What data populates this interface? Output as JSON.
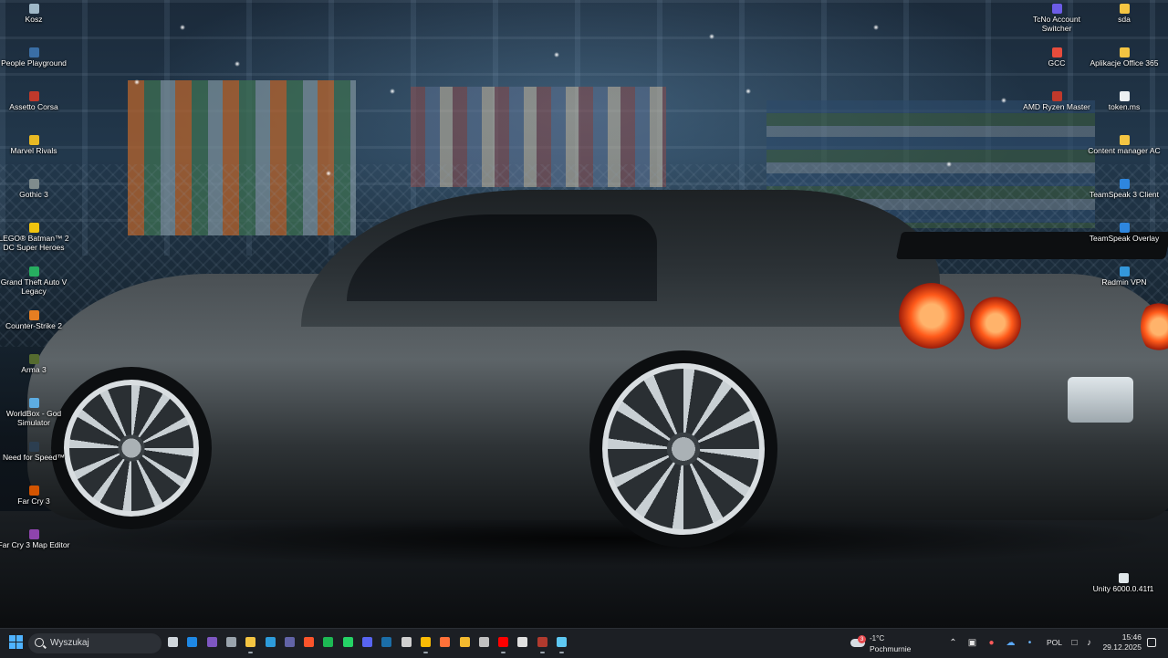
{
  "desktop": {
    "icons_left": [
      {
        "label": "Kosz",
        "icon": "recycle-bin-icon",
        "color": "#9fb8c8"
      },
      {
        "label": "People Playground",
        "icon": "people-playground-icon",
        "color": "#3a6ea5"
      },
      {
        "label": "Assetto Corsa",
        "icon": "assetto-corsa-icon",
        "color": "#c0392b"
      },
      {
        "label": "Marvel Rivals",
        "icon": "marvel-rivals-icon",
        "color": "#e8b923"
      },
      {
        "label": "Gothic 3",
        "icon": "gothic-3-icon",
        "color": "#7f8c8d"
      },
      {
        "label": "LEGO® Batman™ 2 DC Super Heroes",
        "icon": "lego-batman-icon",
        "color": "#f1c40f"
      },
      {
        "label": "Grand Theft Auto V Legacy",
        "icon": "gta-v-icon",
        "color": "#27ae60"
      },
      {
        "label": "Counter-Strike 2",
        "icon": "counter-strike-icon",
        "color": "#e67e22"
      },
      {
        "label": "Arma 3",
        "icon": "arma-3-icon",
        "color": "#556b2f"
      },
      {
        "label": "WorldBox - God Simulator",
        "icon": "worldbox-icon",
        "color": "#5dade2"
      },
      {
        "label": "Need for Speed™",
        "icon": "need-for-speed-icon",
        "color": "#2c3e50"
      },
      {
        "label": "Far Cry 3",
        "icon": "far-cry-3-icon",
        "color": "#d35400"
      },
      {
        "label": "Far Cry 3 Map Editor",
        "icon": "far-cry-3-map-editor-icon",
        "color": "#8e44ad"
      }
    ],
    "icons_right_col1": [
      {
        "label": "TcNo Account Switcher",
        "icon": "tcno-account-switcher-icon",
        "color": "#6c5ce7"
      },
      {
        "label": "GCC",
        "icon": "gcc-icon",
        "color": "#e74c3c"
      },
      {
        "label": "AMD Ryzen Master",
        "icon": "amd-ryzen-master-icon",
        "color": "#c0392b"
      }
    ],
    "icons_right_col2": [
      {
        "label": "sda",
        "icon": "folder-icon",
        "color": "#f4c542"
      },
      {
        "label": "Aplikacje Office 365",
        "icon": "folder-icon",
        "color": "#f4c542"
      },
      {
        "label": "token.ms",
        "icon": "file-icon",
        "color": "#ecf0f1"
      },
      {
        "label": "Content manager AC",
        "icon": "folder-icon",
        "color": "#f4c542"
      },
      {
        "label": "TeamSpeak 3 Client",
        "icon": "teamspeak-icon",
        "color": "#2e86de"
      },
      {
        "label": "TeamSpeak Overlay",
        "icon": "teamspeak-overlay-icon",
        "color": "#2e86de"
      },
      {
        "label": "Radmin VPN",
        "icon": "radmin-vpn-icon",
        "color": "#3498db"
      }
    ],
    "icon_bottom_right": {
      "label": "Unity 6000.0.41f1",
      "icon": "unity-icon",
      "color": "#dfe6e9"
    }
  },
  "taskbar": {
    "search_placeholder": "Wyszukaj",
    "pinned_apps": [
      {
        "name": "task-view-icon",
        "color": "#cfd6dc",
        "running": false
      },
      {
        "name": "edge-icon",
        "color": "#1e88e5",
        "running": false
      },
      {
        "name": "copilot-icon",
        "color": "#7e57c2",
        "running": false
      },
      {
        "name": "widget-app-icon",
        "color": "#9aa4ad",
        "running": false
      },
      {
        "name": "file-explorer-icon",
        "color": "#f4c542",
        "running": true
      },
      {
        "name": "store-icon",
        "color": "#2d9cdb",
        "running": false
      },
      {
        "name": "teams-icon",
        "color": "#6264a7",
        "running": false
      },
      {
        "name": "brave-icon",
        "color": "#fb542b",
        "running": false
      },
      {
        "name": "spotify-icon",
        "color": "#1db954",
        "running": false
      },
      {
        "name": "whatsapp-icon",
        "color": "#25d366",
        "running": false
      },
      {
        "name": "discord-icon",
        "color": "#5865f2",
        "running": false
      },
      {
        "name": "steam-icon",
        "color": "#1b6ea8",
        "running": false
      },
      {
        "name": "epic-games-icon",
        "color": "#d0d0d0",
        "running": false
      },
      {
        "name": "chrome-icon",
        "color": "#fbbc05",
        "running": true
      },
      {
        "name": "firefox-icon",
        "color": "#ff7139",
        "running": false
      },
      {
        "name": "binance-icon",
        "color": "#f3ba2f",
        "running": false
      },
      {
        "name": "obs-icon",
        "color": "#c0c0c0",
        "running": false
      },
      {
        "name": "youtube-icon",
        "color": "#ff0000",
        "running": true
      },
      {
        "name": "paint-icon",
        "color": "#e0e0e0",
        "running": false
      },
      {
        "name": "winrar-icon",
        "color": "#b03a2e",
        "running": true
      },
      {
        "name": "notepad-icon",
        "color": "#5ec8f2",
        "running": true
      }
    ],
    "weather": {
      "badge": "3",
      "temperature": "-1°C",
      "condition": "Pochmurnie"
    },
    "tray": {
      "icons": [
        "chevron-up-icon",
        "gpu-tray-icon",
        "security-tray-icon",
        "onedrive-icon",
        "microphone-icon"
      ],
      "language": "POL",
      "status_icons": [
        "network-icon",
        "volume-icon"
      ],
      "time": "15:46",
      "date": "29.12.2025"
    }
  }
}
